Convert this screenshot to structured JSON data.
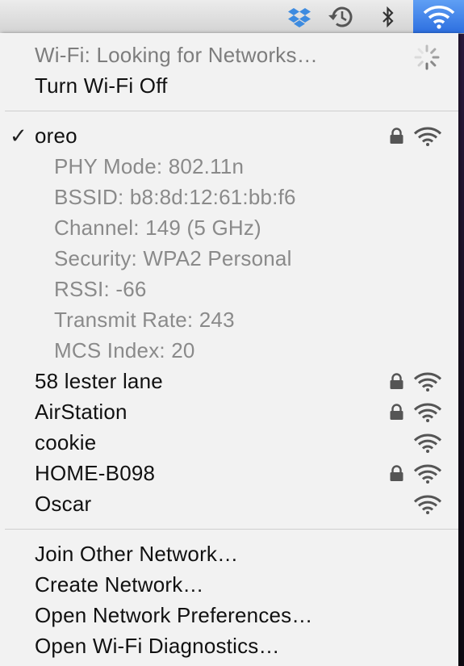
{
  "status": {
    "text": "Wi-Fi: Looking for Networks…"
  },
  "toggle": {
    "label": "Turn Wi-Fi Off"
  },
  "current_network": {
    "name": "oreo",
    "details": {
      "phy": "PHY Mode: 802.11n",
      "bssid": "BSSID: b8:8d:12:61:bb:f6",
      "channel": "Channel: 149 (5 GHz)",
      "security": "Security: WPA2 Personal",
      "rssi": "RSSI: -66",
      "rate": "Transmit Rate: 243",
      "mcs": "MCS Index: 20"
    }
  },
  "networks": [
    {
      "name": "58 lester lane",
      "locked": true
    },
    {
      "name": "AirStation",
      "locked": true
    },
    {
      "name": "cookie",
      "locked": false
    },
    {
      "name": "HOME-B098",
      "locked": true
    },
    {
      "name": "Oscar",
      "locked": false
    }
  ],
  "actions": {
    "join": "Join Other Network…",
    "create": "Create Network…",
    "prefs": "Open Network Preferences…",
    "diagnostics": "Open Wi-Fi Diagnostics…"
  },
  "menubar_icons": [
    "dropbox-icon",
    "time-machine-icon",
    "bluetooth-icon",
    "wifi-icon"
  ],
  "colors": {
    "accent": "#2d6fe0",
    "menu_bg": "#f6f6f6",
    "disabled_text": "#7d7d7d"
  }
}
